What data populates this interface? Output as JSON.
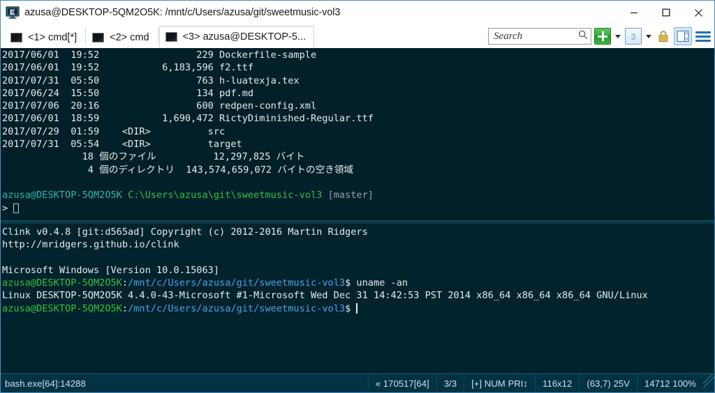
{
  "window": {
    "title": "azusa@DESKTOP-5QM2O5K: /mnt/c/Users/azusa/git/sweetmusic-vol3",
    "app_icon": "conemu-monitor-icon",
    "controls": {
      "minimize": "minimize-icon",
      "maximize": "maximize-icon",
      "close": "close-icon"
    }
  },
  "tabs": [
    {
      "label": "<1> cmd[*]",
      "active": false
    },
    {
      "label": "<2> cmd",
      "active": false
    },
    {
      "label": "<3> azusa@DESKTOP-5...",
      "active": true
    }
  ],
  "toolbar": {
    "search_placeholder": "Search",
    "search_value": "",
    "new_console_label": "+",
    "active_console_count": "3",
    "icons": [
      "search-icon",
      "plus-icon",
      "dropdown-caret-icon",
      "lock-icon",
      "split-pane-icon",
      "hamburger-menu-icon"
    ]
  },
  "terminal": {
    "top_pane": [
      {
        "segments": [
          {
            "text": "2017/06/01  19:52                 229 Dockerfile-sample",
            "color": "white"
          }
        ]
      },
      {
        "segments": [
          {
            "text": "2017/06/01  19:52           6,183,596 f2.ttf",
            "color": "white"
          }
        ]
      },
      {
        "segments": [
          {
            "text": "2017/07/31  05:50                 763 h-luatexja.tex",
            "color": "white"
          }
        ]
      },
      {
        "segments": [
          {
            "text": "2017/06/24  15:50                 134 pdf.md",
            "color": "white"
          }
        ]
      },
      {
        "segments": [
          {
            "text": "2017/07/06  20:16                 600 redpen-config.xml",
            "color": "white"
          }
        ]
      },
      {
        "segments": [
          {
            "text": "2017/06/01  18:59           1,690,472 RictyDiminished-Regular.ttf",
            "color": "white"
          }
        ]
      },
      {
        "segments": [
          {
            "text": "2017/07/29  01:59    <DIR>          src",
            "color": "white"
          }
        ]
      },
      {
        "segments": [
          {
            "text": "2017/07/31  05:54    <DIR>          target",
            "color": "white"
          }
        ]
      },
      {
        "segments": [
          {
            "text": "              18 個のファイル          12,297,825 バイト",
            "color": "white"
          }
        ]
      },
      {
        "segments": [
          {
            "text": "               4 個のディレクトリ  143,574,659,072 バイトの空き領域",
            "color": "white"
          }
        ]
      },
      {
        "segments": [
          {
            "text": "",
            "color": "white"
          }
        ]
      },
      {
        "segments": [
          {
            "text": "azusa@DESKTOP-5QM2O5K",
            "color": "teal"
          },
          {
            "text": " ",
            "color": "white"
          },
          {
            "text": "C:\\Users\\azusa\\git\\sweetmusic-vol3",
            "color": "gitgreen"
          },
          {
            "text": " ",
            "color": "white"
          },
          {
            "text": "[master]",
            "color": "gray"
          }
        ]
      },
      {
        "segments": [
          {
            "text": "> ",
            "color": "white"
          }
        ],
        "cursor": "box"
      }
    ],
    "bottom_pane": [
      {
        "segments": [
          {
            "text": "Clink v0.4.8 [git:d565ad] Copyright (c) 2012-2016 Martin Ridgers",
            "color": "white"
          }
        ]
      },
      {
        "segments": [
          {
            "text": "http://mridgers.github.io/clink",
            "color": "white"
          }
        ]
      },
      {
        "segments": [
          {
            "text": "",
            "color": "white"
          }
        ]
      },
      {
        "segments": [
          {
            "text": "Microsoft Windows [Version 10.0.15063]",
            "color": "white"
          }
        ]
      },
      {
        "segments": [
          {
            "text": "azusa@DESKTOP-5QM2O5K",
            "color": "green"
          },
          {
            "text": ":",
            "color": "white"
          },
          {
            "text": "/mnt/c/Users/azusa/git/sweetmusic-vol3",
            "color": "blue"
          },
          {
            "text": "$ uname -an",
            "color": "white"
          }
        ]
      },
      {
        "segments": [
          {
            "text": "Linux DESKTOP-5QM2O5K 4.4.0-43-Microsoft #1-Microsoft Wed Dec 31 14:42:53 PST 2014 x86_64 x86_64 x86_64 GNU/Linux",
            "color": "white"
          }
        ]
      },
      {
        "segments": [
          {
            "text": "azusa@DESKTOP-5QM2O5K",
            "color": "green"
          },
          {
            "text": ":",
            "color": "white"
          },
          {
            "text": "/mnt/c/Users/azusa/git/sweetmusic-vol3",
            "color": "blue"
          },
          {
            "text": "$ ",
            "color": "white"
          }
        ],
        "cursor": "bar"
      }
    ]
  },
  "statusbar": {
    "process": "bash.exe[64]:14288",
    "cells": [
      "« 170517[64]",
      "3/3",
      "[+] NUM  PRI↕",
      "116x12",
      "(63,7) 25V",
      "14712 100%"
    ]
  }
}
